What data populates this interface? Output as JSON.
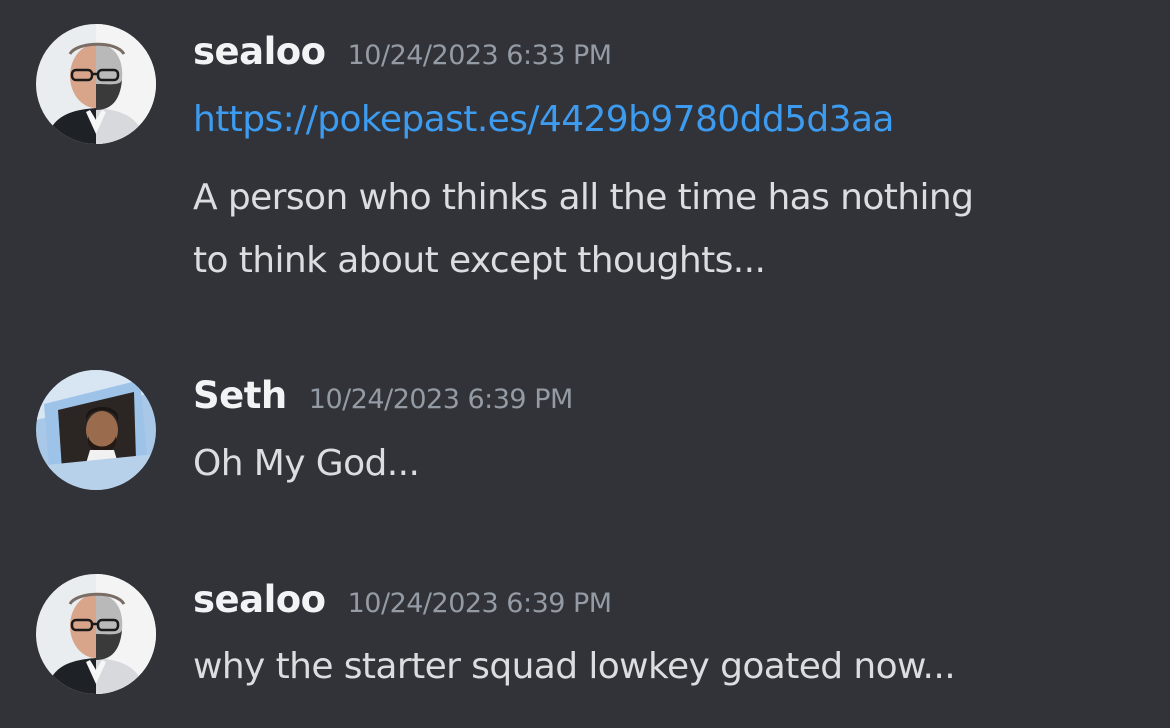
{
  "messages": [
    {
      "username": "sealoo",
      "timestamp": "10/24/2023 6:33 PM",
      "link": "https://pokepast.es/4429b9780dd5d3aa",
      "lines": [
        "A person who thinks all the time has nothing",
        "to think about except thoughts..."
      ],
      "avatar_icon": "split-face-avatar"
    },
    {
      "username": "Seth",
      "timestamp": "10/24/2023 6:39 PM",
      "lines": [
        "Oh My God..."
      ],
      "avatar_icon": "car-window-avatar"
    },
    {
      "username": "sealoo",
      "timestamp": "10/24/2023 6:39 PM",
      "lines": [
        "why the starter squad lowkey goated now..."
      ],
      "avatar_icon": "split-face-avatar"
    }
  ],
  "colors": {
    "background": "#313338",
    "username": "#f2f3f5",
    "timestamp": "#949ba4",
    "text": "#dbdee1",
    "link": "#3d9bf0"
  }
}
